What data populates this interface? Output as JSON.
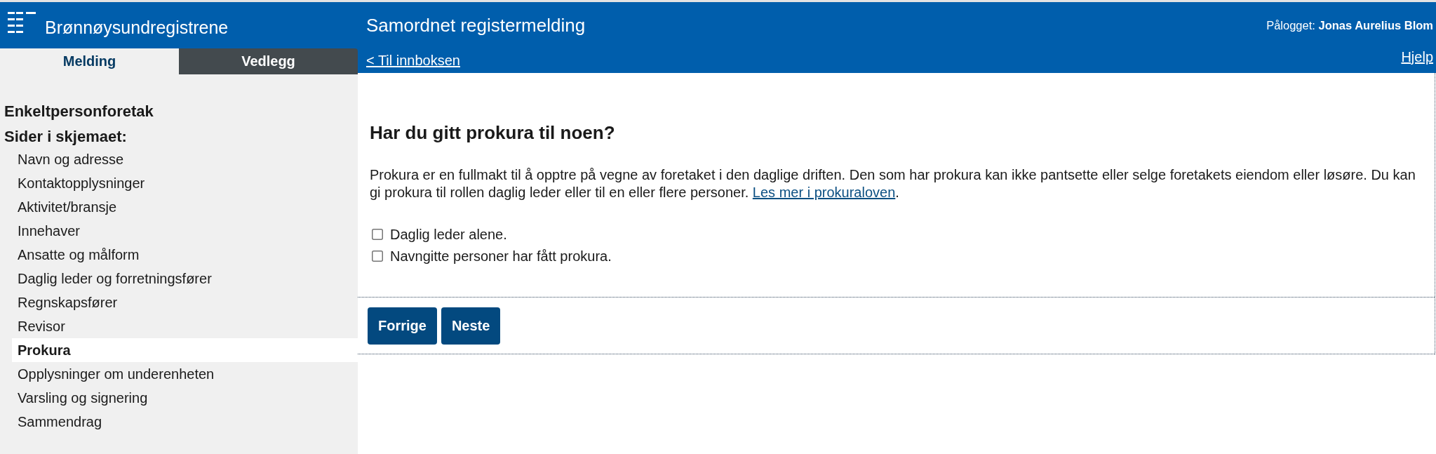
{
  "header": {
    "logo_text": "Brønnøysundregistrene",
    "title": "Samordnet registermelding",
    "logged_in": "Pålogget: **Jonas Aurelius Blom**",
    "back_link": "< Til innboksen",
    "help_link": "Hjelp"
  },
  "tabs": [
    {
      "label": "Melding",
      "selected": true
    },
    {
      "label": "Vedlegg",
      "selected": false
    }
  ],
  "sidebar": {
    "title": "Enkeltpersonforetak",
    "subtitle": "Sider i skjemaet:",
    "items": [
      {
        "label": "Navn og adresse",
        "selected": false
      },
      {
        "label": "Kontaktopplysninger",
        "selected": false
      },
      {
        "label": "Aktivitet/bransje",
        "selected": false
      },
      {
        "label": "Innehaver",
        "selected": false
      },
      {
        "label": "Ansatte og målform",
        "selected": false
      },
      {
        "label": "Daglig leder og forretningsfører",
        "selected": false
      },
      {
        "label": "Regnskapsfører",
        "selected": false
      },
      {
        "label": "Revisor",
        "selected": false
      },
      {
        "label": "Prokura",
        "selected": true
      },
      {
        "label": "Opplysninger om underenheten",
        "selected": false
      },
      {
        "label": "Varsling og signering",
        "selected": false
      },
      {
        "label": "Sammendrag",
        "selected": false
      }
    ]
  },
  "main": {
    "heading": "Har du gitt prokura til noen?",
    "description": "Prokura er en fullmakt til å opptre på vegne av foretaket i den daglige driften. Den som har prokura kan ikke pantsette eller selge foretakets eiendom eller løsøre. Du kan gi prokura til rollen daglig leder eller til en eller flere personer.",
    "link": "Les mer i prokuraloven",
    "description_end": ".",
    "options": [
      {
        "label": "Daglig leder alene.",
        "checked": false
      },
      {
        "label": "Navngitte personer har fått prokura.",
        "checked": false
      }
    ]
  },
  "navigation": {
    "previous": "Forrige",
    "next": "Neste"
  }
}
